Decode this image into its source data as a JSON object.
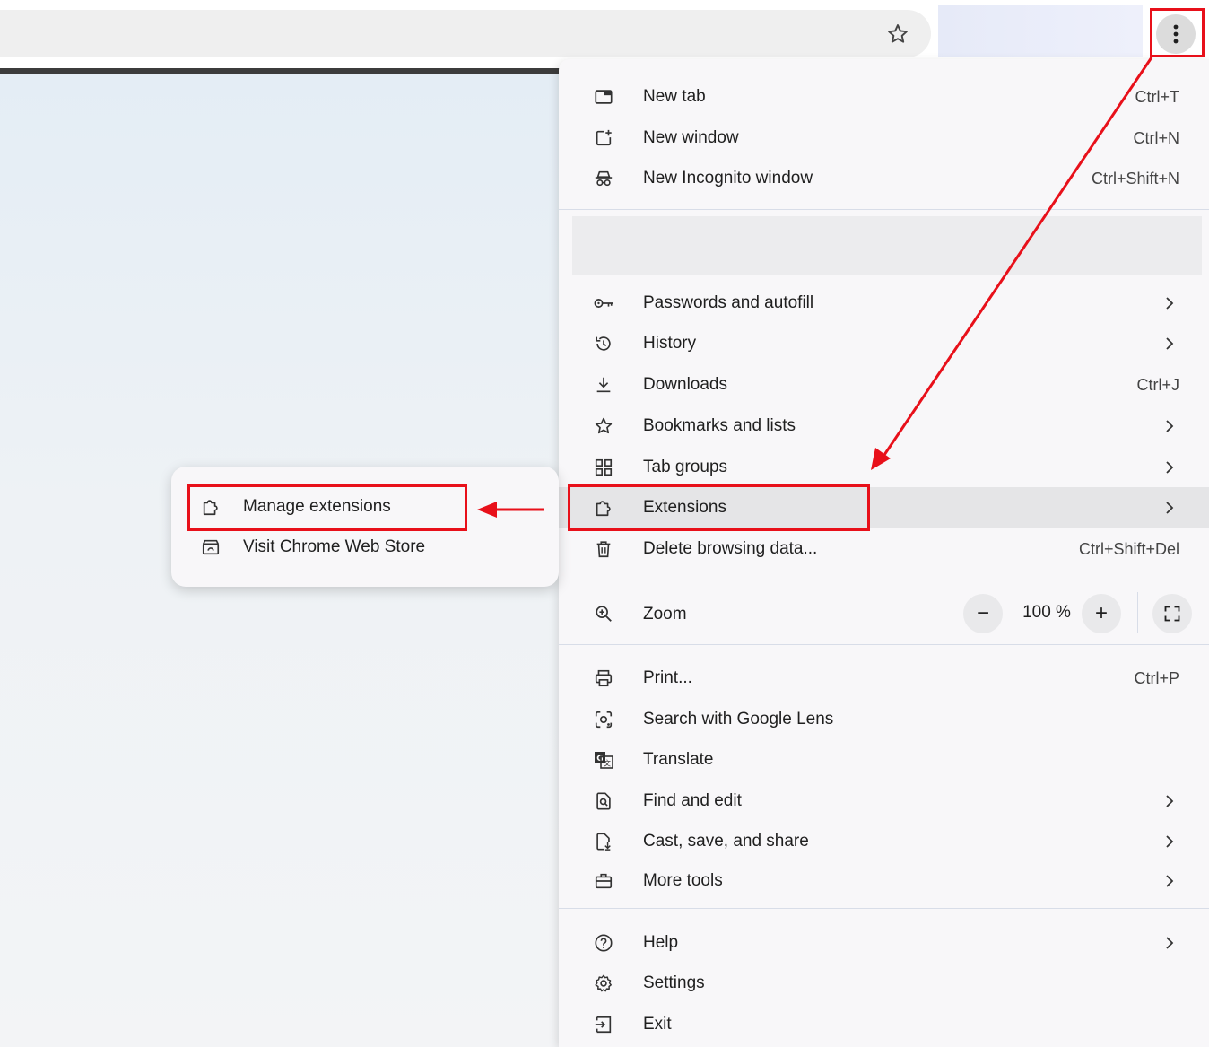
{
  "toolbar": {
    "bookmark_icon": "star-outline-icon",
    "menu_icon": "three-dots-vertical-icon"
  },
  "menu": {
    "group1": [
      {
        "label": "New tab",
        "shortcut": "Ctrl+T",
        "icon": "new-tab-icon"
      },
      {
        "label": "New window",
        "shortcut": "Ctrl+N",
        "icon": "new-window-icon"
      },
      {
        "label": "New Incognito window",
        "shortcut": "Ctrl+Shift+N",
        "icon": "incognito-icon"
      }
    ],
    "group2": [
      {
        "label": "Passwords and autofill",
        "icon": "key-icon",
        "submenu": true
      },
      {
        "label": "History",
        "icon": "history-icon",
        "submenu": true
      },
      {
        "label": "Downloads",
        "shortcut": "Ctrl+J",
        "icon": "download-icon"
      },
      {
        "label": "Bookmarks and lists",
        "icon": "star-icon",
        "submenu": true
      },
      {
        "label": "Tab groups",
        "icon": "grid-icon",
        "submenu": true
      },
      {
        "label": "Extensions",
        "icon": "puzzle-icon",
        "submenu": true,
        "highlighted": true
      },
      {
        "label": "Delete browsing data...",
        "shortcut": "Ctrl+Shift+Del",
        "icon": "trash-icon"
      }
    ],
    "zoom": {
      "label": "Zoom",
      "value": "100 %",
      "minus": "−",
      "plus": "+"
    },
    "group3": [
      {
        "label": "Print...",
        "shortcut": "Ctrl+P",
        "icon": "printer-icon"
      },
      {
        "label": "Search with Google Lens",
        "icon": "lens-icon"
      },
      {
        "label": "Translate",
        "icon": "translate-icon"
      },
      {
        "label": "Find and edit",
        "icon": "find-icon",
        "submenu": true
      },
      {
        "label": "Cast, save, and share",
        "icon": "cast-save-icon",
        "submenu": true
      },
      {
        "label": "More tools",
        "icon": "toolbox-icon",
        "submenu": true
      }
    ],
    "group4": [
      {
        "label": "Help",
        "icon": "help-icon",
        "submenu": true
      },
      {
        "label": "Settings",
        "icon": "gear-icon"
      },
      {
        "label": "Exit",
        "icon": "exit-icon"
      }
    ]
  },
  "submenu": {
    "items": [
      {
        "label": "Manage extensions",
        "icon": "puzzle-icon"
      },
      {
        "label": "Visit Chrome Web Store",
        "icon": "web-store-icon"
      }
    ]
  },
  "annotations": {
    "color": "#e8101a"
  }
}
